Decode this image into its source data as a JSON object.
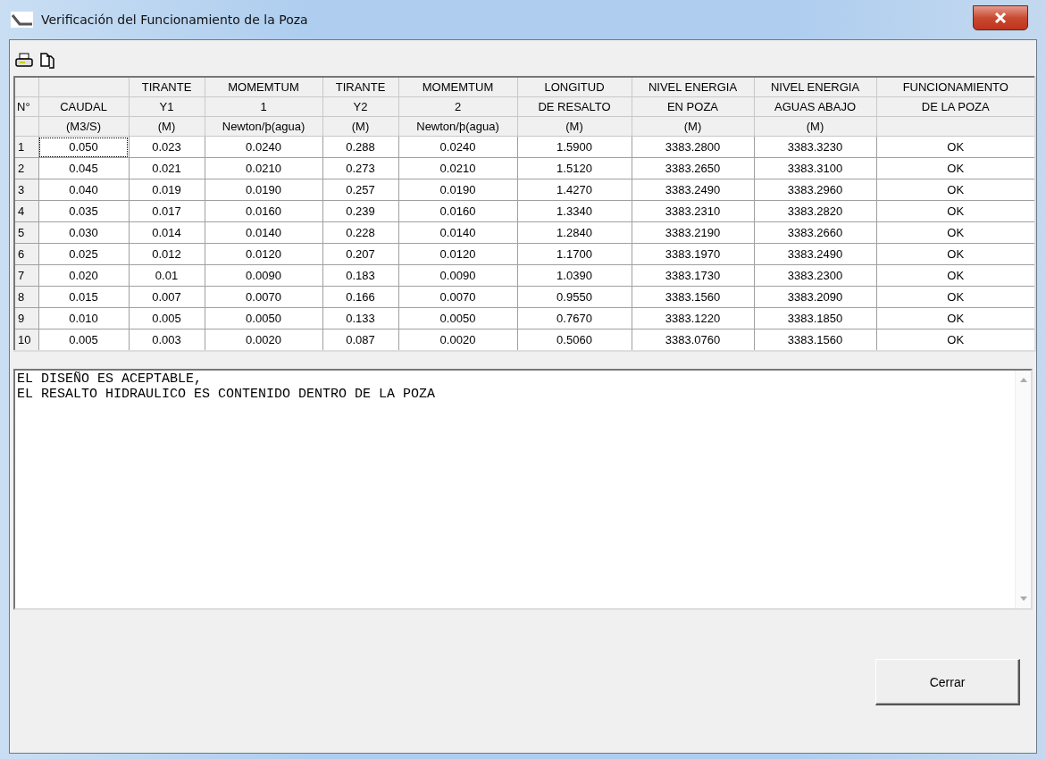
{
  "window": {
    "title": "Verificación del Funcionamiento de la Poza"
  },
  "table": {
    "header_rows": [
      [
        null,
        null,
        "TIRANTE",
        "MOMEMTUM",
        "TIRANTE",
        "MOMEMTUM",
        "LONGITUD",
        "NIVEL ENERGIA",
        "NIVEL ENERGIA",
        "FUNCIONAMIENTO"
      ],
      [
        "N°",
        "CAUDAL",
        "Y1",
        "1",
        "Y2",
        "2",
        "DE RESALTO",
        "EN POZA",
        "AGUAS ABAJO",
        "DE LA POZA"
      ],
      [
        null,
        "(M3/S)",
        "(M)",
        "Newton/þ(agua)",
        "(M)",
        "Newton/þ(agua)",
        "(M)",
        "(M)",
        "(M)",
        null
      ]
    ],
    "rows": [
      {
        "focused": true,
        "cells": [
          "1",
          "0.050",
          "0.023",
          "0.0240",
          "0.288",
          "0.0240",
          "1.5900",
          "3383.2800",
          "3383.3230",
          "OK"
        ]
      },
      {
        "focused": false,
        "cells": [
          "2",
          "0.045",
          "0.021",
          "0.0210",
          "0.273",
          "0.0210",
          "1.5120",
          "3383.2650",
          "3383.3100",
          "OK"
        ]
      },
      {
        "focused": false,
        "cells": [
          "3",
          "0.040",
          "0.019",
          "0.0190",
          "0.257",
          "0.0190",
          "1.4270",
          "3383.2490",
          "3383.2960",
          "OK"
        ]
      },
      {
        "focused": false,
        "cells": [
          "4",
          "0.035",
          "0.017",
          "0.0160",
          "0.239",
          "0.0160",
          "1.3340",
          "3383.2310",
          "3383.2820",
          "OK"
        ]
      },
      {
        "focused": false,
        "cells": [
          "5",
          "0.030",
          "0.014",
          "0.0140",
          "0.228",
          "0.0140",
          "1.2840",
          "3383.2190",
          "3383.2660",
          "OK"
        ]
      },
      {
        "focused": false,
        "cells": [
          "6",
          "0.025",
          "0.012",
          "0.0120",
          "0.207",
          "0.0120",
          "1.1700",
          "3383.1970",
          "3383.2490",
          "OK"
        ]
      },
      {
        "focused": false,
        "cells": [
          "7",
          "0.020",
          "0.01",
          "0.0090",
          "0.183",
          "0.0090",
          "1.0390",
          "3383.1730",
          "3383.2300",
          "OK"
        ]
      },
      {
        "focused": false,
        "cells": [
          "8",
          "0.015",
          "0.007",
          "0.0070",
          "0.166",
          "0.0070",
          "0.9550",
          "3383.1560",
          "3383.2090",
          "OK"
        ]
      },
      {
        "focused": false,
        "cells": [
          "9",
          "0.010",
          "0.005",
          "0.0050",
          "0.133",
          "0.0050",
          "0.7670",
          "3383.1220",
          "3383.1850",
          "OK"
        ]
      },
      {
        "focused": false,
        "cells": [
          "10",
          "0.005",
          "0.003",
          "0.0020",
          "0.087",
          "0.0020",
          "0.5060",
          "3383.0760",
          "3383.1560",
          "OK"
        ]
      }
    ]
  },
  "result_text": [
    "EL DISEÑO ES ACEPTABLE,",
    "EL RESALTO HIDRAULICO ES CONTENIDO DENTRO DE LA POZA"
  ],
  "buttons": [
    "Cerrar"
  ]
}
